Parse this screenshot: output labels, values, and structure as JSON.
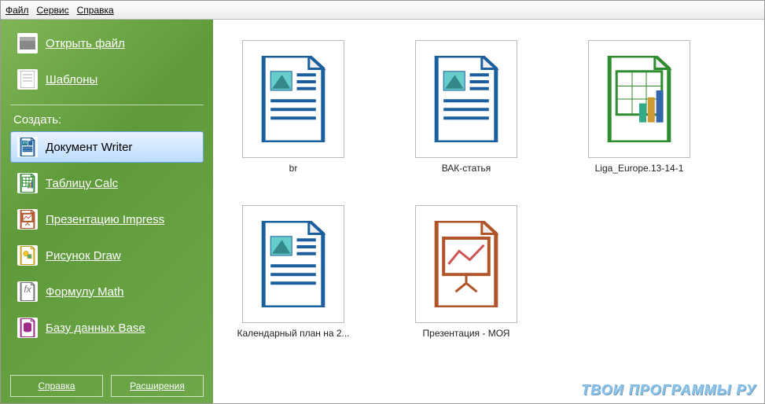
{
  "menubar": {
    "file": "Файл",
    "service": "Сервис",
    "help": "Справка"
  },
  "sidebar": {
    "open": "Открыть файл",
    "templates": "Шаблоны",
    "create_heading": "Создать:",
    "items": [
      {
        "label": "Документ Writer",
        "icon": "writer"
      },
      {
        "label": "Таблицу Calc",
        "icon": "calc"
      },
      {
        "label": "Презентацию Impress",
        "icon": "impress"
      },
      {
        "label": "Рисунок Draw",
        "icon": "draw"
      },
      {
        "label": "Формулу Math",
        "icon": "math"
      },
      {
        "label": "Базу данных Base",
        "icon": "base"
      }
    ],
    "btn_help": "Справка",
    "btn_ext": "Расширения"
  },
  "gallery": [
    {
      "label": "br",
      "icon": "writer"
    },
    {
      "label": "ВАК-статья",
      "icon": "writer"
    },
    {
      "label": "Liga_Europe.13-14-1",
      "icon": "calc"
    },
    {
      "label": "Календарный план на 2...",
      "icon": "writer"
    },
    {
      "label": "Презентация  - МОЯ",
      "icon": "impress"
    }
  ],
  "watermark": "ТВОИ ПРОГРАММЫ РУ"
}
